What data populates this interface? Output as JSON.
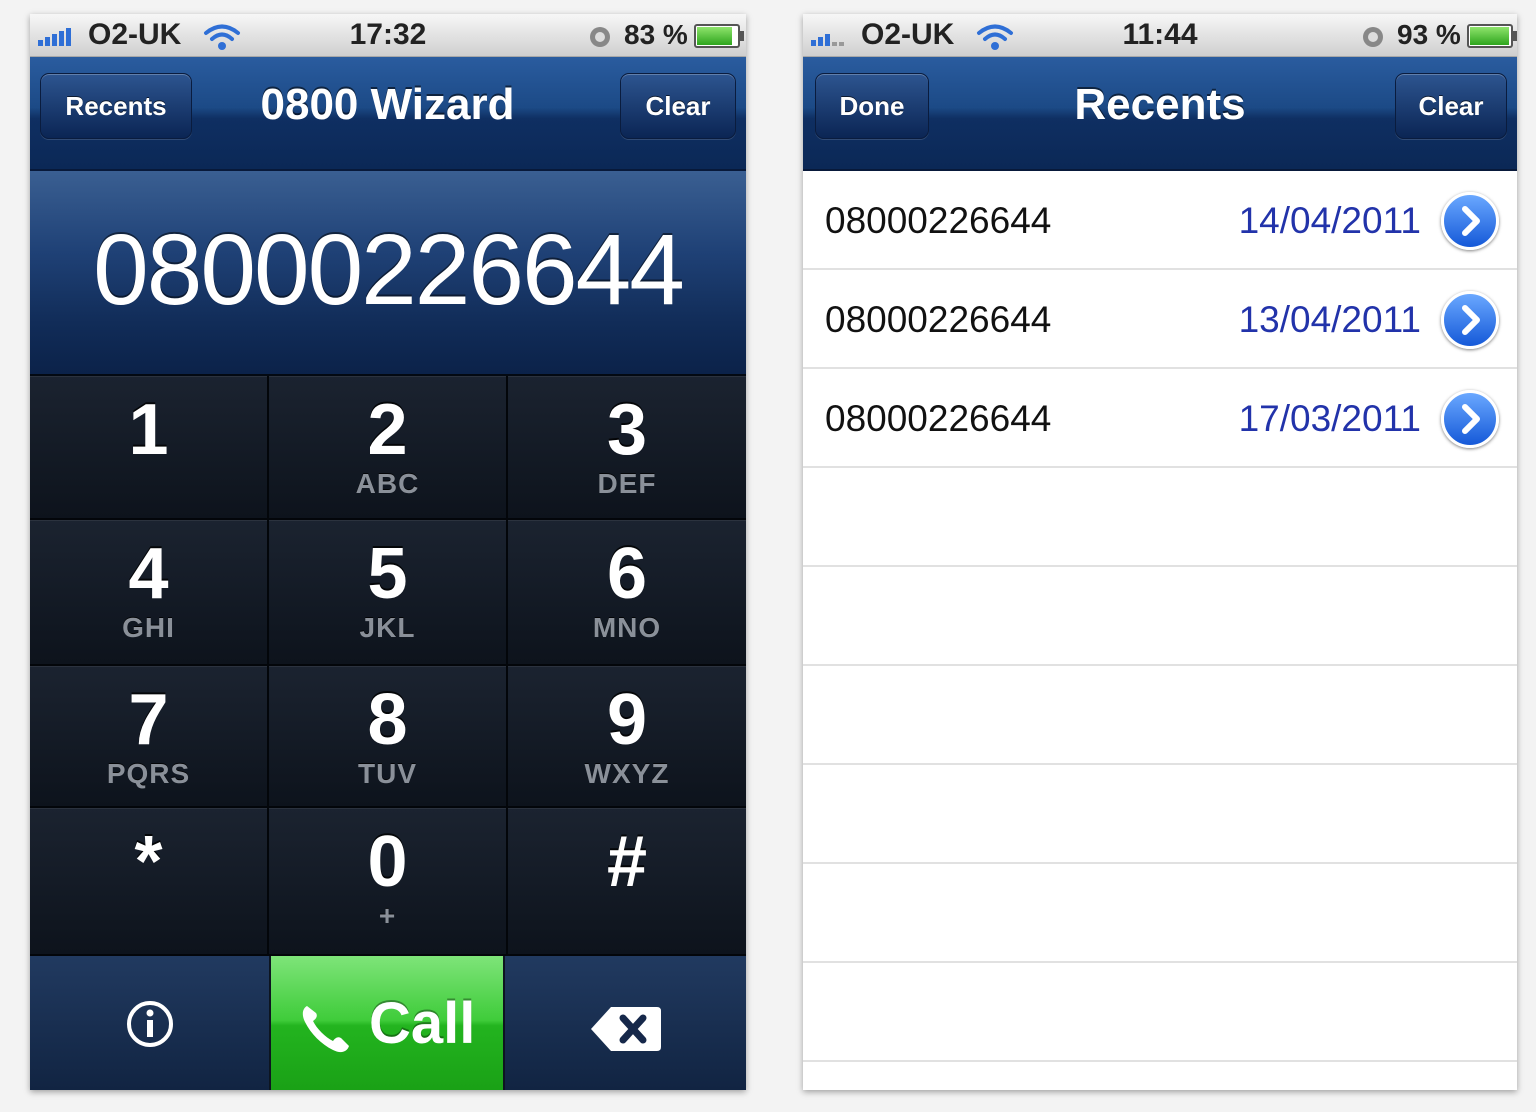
{
  "colors": {
    "nav_blue": "#1c4a86",
    "call_green": "#3fcc3a",
    "date_blue": "#2233aa",
    "keypad_dark": "#0d131c"
  },
  "dialer": {
    "status": {
      "carrier": "O2-UK",
      "time": "17:32",
      "battery_pct": "83 %",
      "battery_level": 0.83
    },
    "nav": {
      "left_button": "Recents",
      "title": "0800 Wizard",
      "right_button": "Clear"
    },
    "display_number": "08000226644",
    "keys": [
      {
        "digit": "1",
        "letters": ""
      },
      {
        "digit": "2",
        "letters": "ABC"
      },
      {
        "digit": "3",
        "letters": "DEF"
      },
      {
        "digit": "4",
        "letters": "GHI"
      },
      {
        "digit": "5",
        "letters": "JKL"
      },
      {
        "digit": "6",
        "letters": "MNO"
      },
      {
        "digit": "7",
        "letters": "PQRS"
      },
      {
        "digit": "8",
        "letters": "TUV"
      },
      {
        "digit": "9",
        "letters": "WXYZ"
      },
      {
        "digit": "*",
        "letters": ""
      },
      {
        "digit": "0",
        "letters": "+"
      },
      {
        "digit": "#",
        "letters": ""
      }
    ],
    "call_label": "Call",
    "icons": {
      "info": "info-icon",
      "phone": "phone-handset-icon",
      "delete": "backspace-icon"
    }
  },
  "recents": {
    "status": {
      "carrier": "O2-UK",
      "time": "11:44",
      "battery_pct": "93 %",
      "battery_level": 0.93
    },
    "nav": {
      "left_button": "Done",
      "title": "Recents",
      "right_button": "Clear"
    },
    "items": [
      {
        "number": "08000226644",
        "date": "14/04/2011"
      },
      {
        "number": "08000226644",
        "date": "13/04/2011"
      },
      {
        "number": "08000226644",
        "date": "17/03/2011"
      }
    ]
  }
}
